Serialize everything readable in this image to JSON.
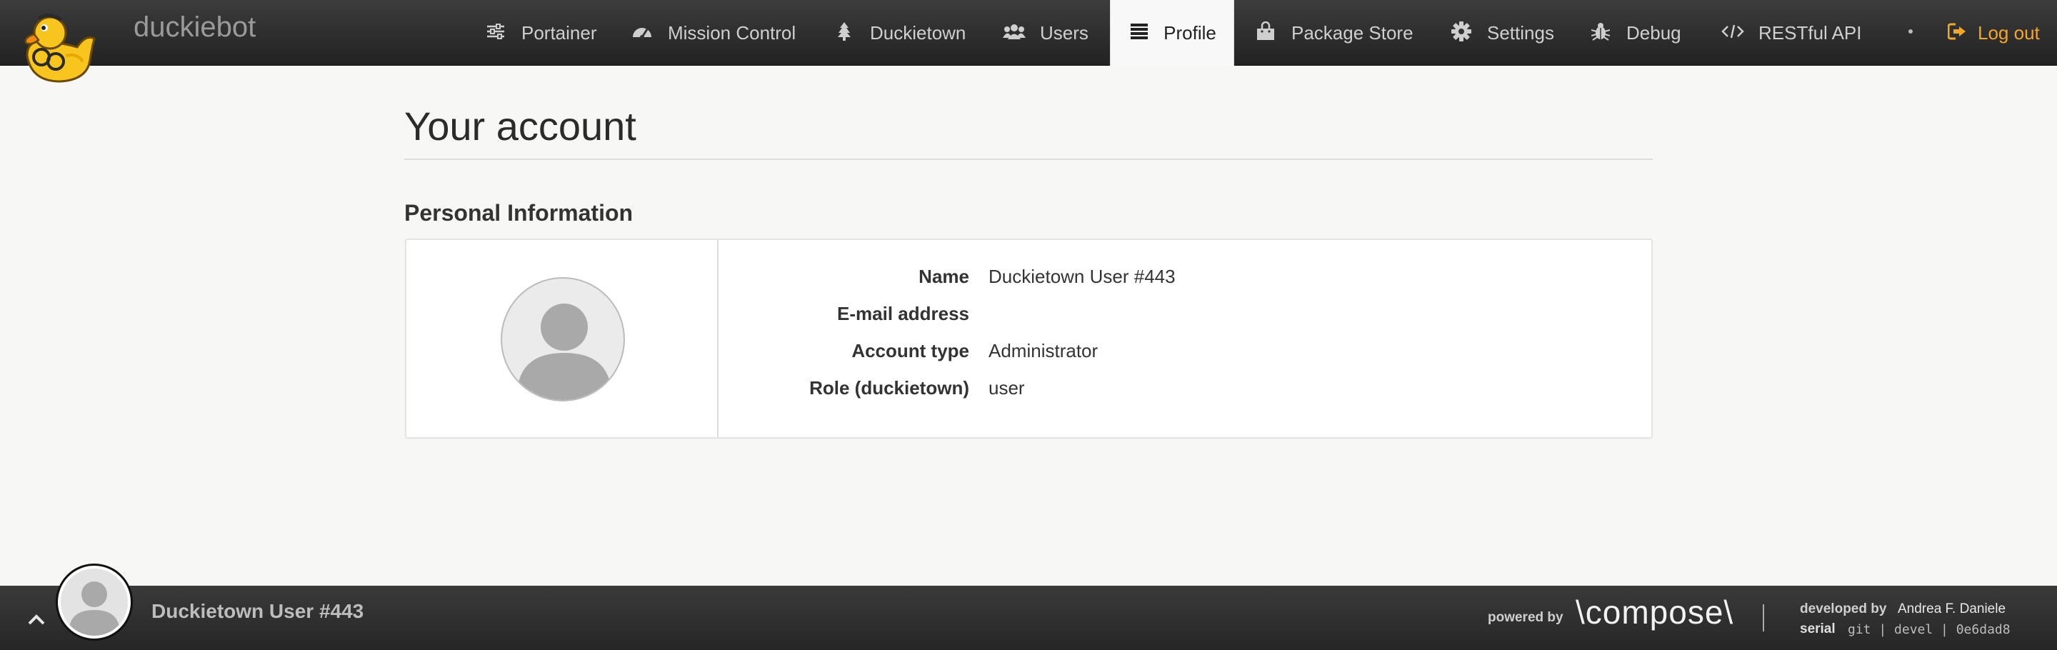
{
  "app": {
    "brand": "duckiebot",
    "logo_icon": "duck-logo-icon"
  },
  "nav": {
    "items": [
      {
        "label": "Portainer",
        "icon": "sliders-icon"
      },
      {
        "label": "Mission Control",
        "icon": "dashboard-icon"
      },
      {
        "label": "Duckietown",
        "icon": "tree-icon"
      },
      {
        "label": "Users",
        "icon": "users-icon"
      },
      {
        "label": "Profile",
        "icon": "list-icon",
        "active": true
      },
      {
        "label": "Package Store",
        "icon": "shopping-bag-icon"
      },
      {
        "label": "Settings",
        "icon": "gear-icon"
      },
      {
        "label": "Debug",
        "icon": "bug-icon"
      },
      {
        "label": "RESTful API",
        "icon": "code-icon"
      }
    ],
    "logout": {
      "label": "Log out",
      "icon": "sign-out-icon"
    },
    "colors": {
      "logout": "#f4a629",
      "active_bg": "#f8f8f8"
    }
  },
  "page": {
    "title": "Your account",
    "section_title": "Personal Information"
  },
  "profile": {
    "fields": [
      {
        "label": "Name",
        "value": "Duckietown User #443"
      },
      {
        "label": "E-mail address",
        "value": ""
      },
      {
        "label": "Account type",
        "value": "Administrator"
      },
      {
        "label": "Role (duckietown)",
        "value": "user"
      }
    ]
  },
  "footer": {
    "username": "Duckietown User #443",
    "powered_by": "powered by",
    "compose": "\\compose\\",
    "developed_by_label": "developed by",
    "developer": "Andrea F. Daniele",
    "serial_label": "serial",
    "serial_value": "git | devel | 0e6dad8"
  }
}
